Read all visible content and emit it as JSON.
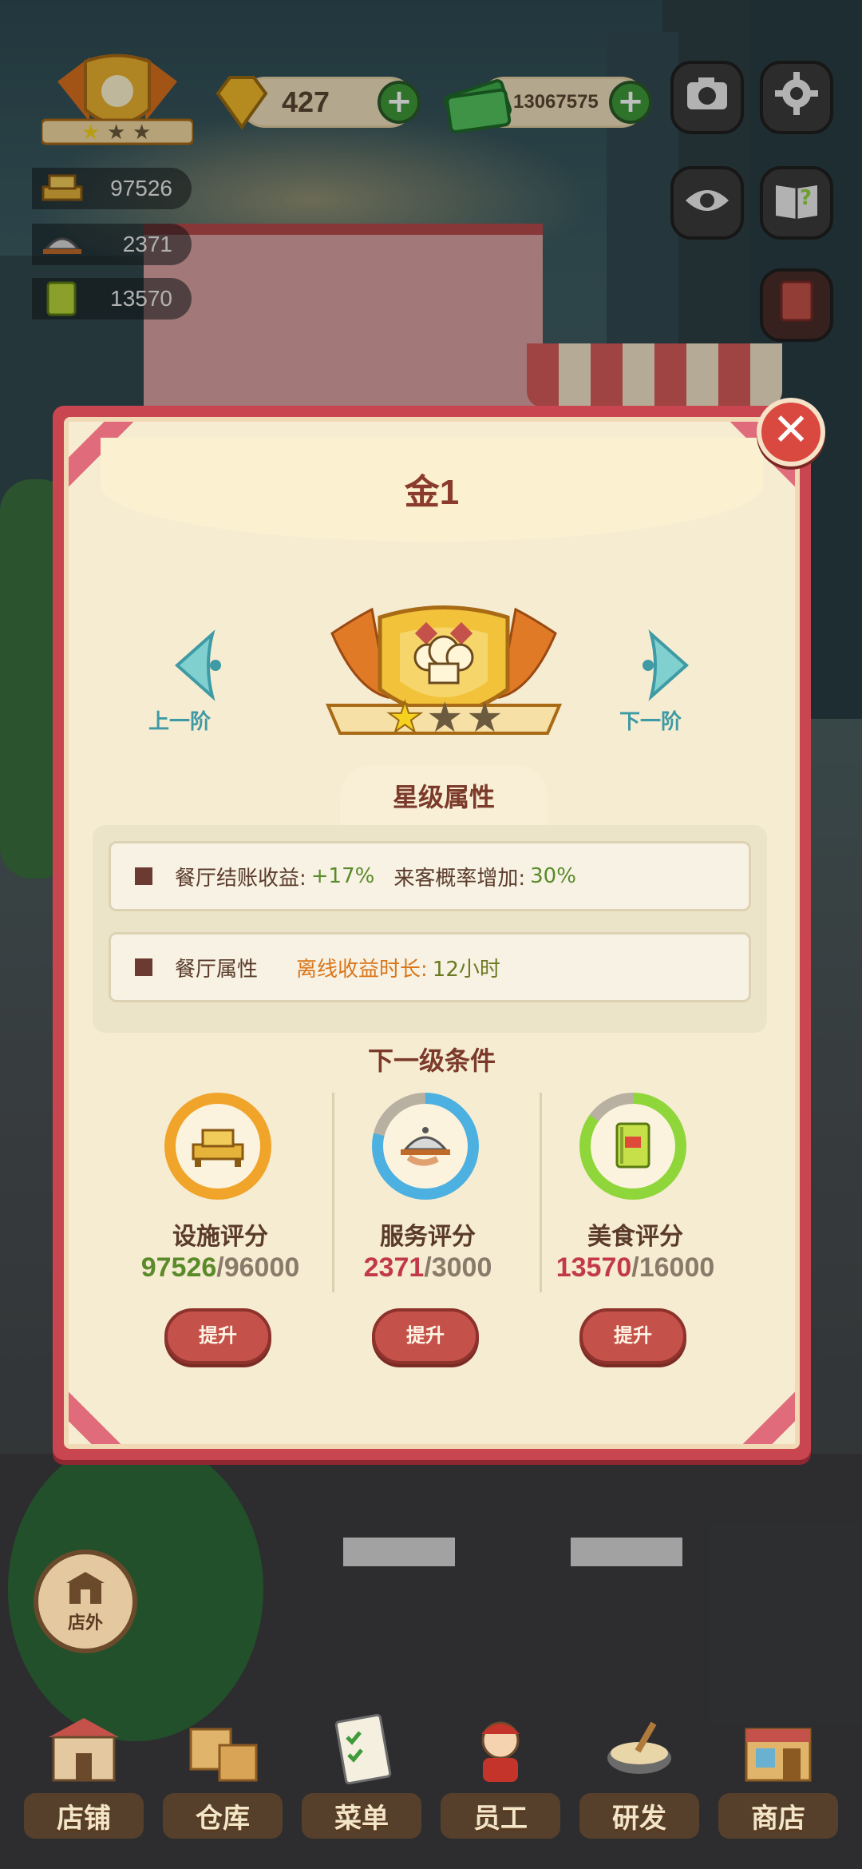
{
  "hud": {
    "gems": "427",
    "cash": "13067575",
    "stats": [
      {
        "icon": "facility-icon",
        "value": "97526"
      },
      {
        "icon": "service-icon",
        "value": "2371"
      },
      {
        "icon": "food-icon",
        "value": "13570"
      }
    ],
    "plus_label": "+",
    "top_icons": [
      "camera-icon",
      "settings-icon",
      "eye-icon",
      "guide-book-icon",
      "recipe-book-icon"
    ]
  },
  "modal": {
    "title": "金1",
    "prev_label": "上一阶",
    "next_label": "下一阶",
    "close_glyph": "✕",
    "badge_stars_filled": 1,
    "badge_stars_total": 3,
    "section_title": "星级属性",
    "attributes": [
      {
        "label": "餐厅结账收益:",
        "value": "+17%",
        "label2": "来客概率增加:",
        "value2": "30%"
      },
      {
        "label": "餐厅属性",
        "label2": "离线收益时长:",
        "value2": "12小时"
      }
    ],
    "next_title": "下一级条件",
    "scores": [
      {
        "label": "设施评分",
        "current": "97526",
        "target": "/96000",
        "current_color": "#5a8a2a",
        "ring_color": "#f0a42a",
        "progress": 1.0,
        "button": "提升"
      },
      {
        "label": "服务评分",
        "current": "2371",
        "target": "/3000",
        "current_color": "#c23a4a",
        "ring_color": "#4cb0e0",
        "progress": 0.79,
        "button": "提升"
      },
      {
        "label": "美食评分",
        "current": "13570",
        "target": "/16000",
        "current_color": "#c23a4a",
        "ring_color": "#8ed63a",
        "progress": 0.85,
        "button": "提升"
      }
    ]
  },
  "outdoor": {
    "label": "店外"
  },
  "nav": [
    {
      "label": "店铺",
      "icon": "shop-icon"
    },
    {
      "label": "仓库",
      "icon": "warehouse-icon"
    },
    {
      "label": "菜单",
      "icon": "menu-icon"
    },
    {
      "label": "员工",
      "icon": "staff-icon"
    },
    {
      "label": "研发",
      "icon": "research-icon"
    },
    {
      "label": "商店",
      "icon": "store-icon"
    }
  ]
}
